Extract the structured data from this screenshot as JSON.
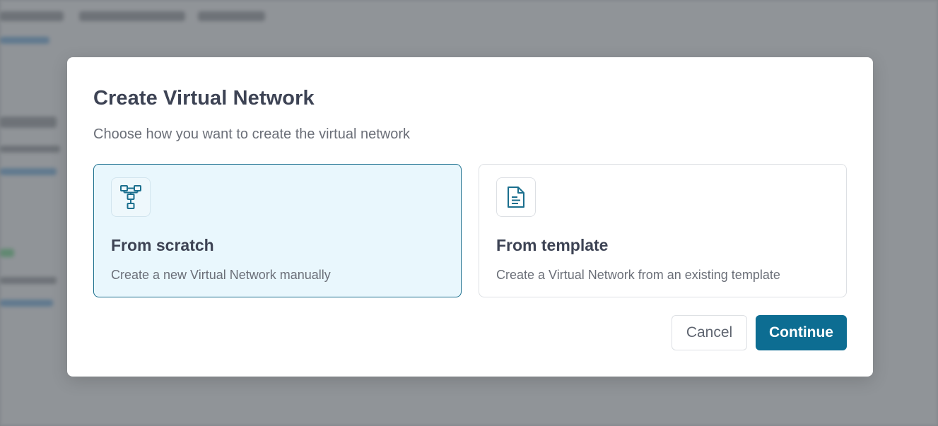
{
  "dialog": {
    "title": "Create Virtual Network",
    "subtitle": "Choose how you want to create the virtual network"
  },
  "options": [
    {
      "id": "scratch",
      "title": "From scratch",
      "description": "Create a new Virtual Network manually",
      "icon": "network-diagram-icon",
      "selected": true
    },
    {
      "id": "template",
      "title": "From template",
      "description": "Create a Virtual Network from an existing template",
      "icon": "document-icon",
      "selected": false
    }
  ],
  "buttons": {
    "cancel_label": "Cancel",
    "continue_label": "Continue"
  },
  "colors": {
    "accent": "#0d6d92",
    "selected_bg": "#e9f7fd",
    "title_text": "#3d4354",
    "muted_text": "#6b6f78"
  }
}
